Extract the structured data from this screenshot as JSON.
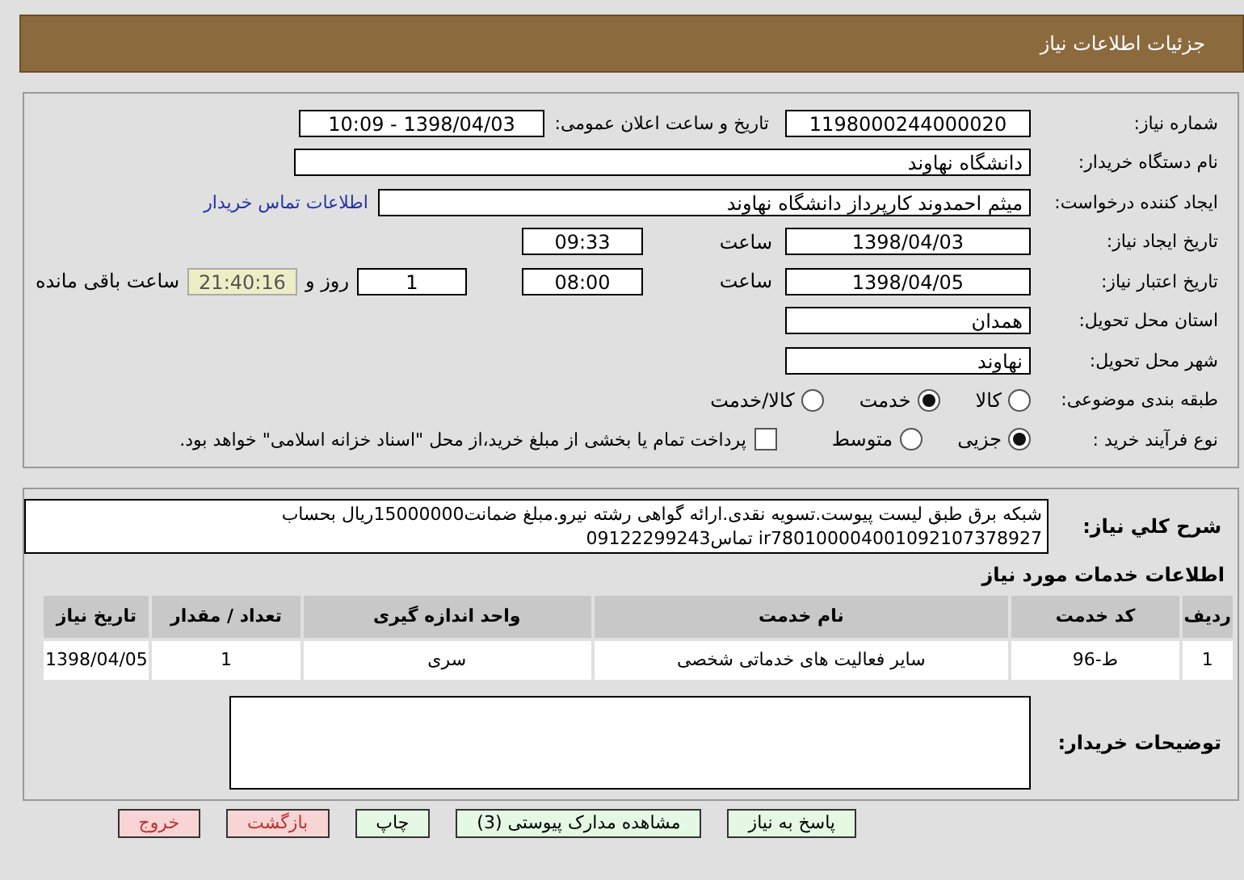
{
  "header": {
    "title": "جزئیات اطلاعات نیاز"
  },
  "form": {
    "need_number": {
      "label": "شماره نیاز:",
      "value": "1198000244000020"
    },
    "announce": {
      "label": "تاریخ و ساعت اعلان عمومی:",
      "value": "1398/04/03 - 10:09"
    },
    "buyer": {
      "label": "نام دستگاه خریدار:",
      "value": "دانشگاه نهاوند"
    },
    "creator": {
      "label": "ایجاد کننده درخواست:",
      "value": "میثم احمدوند کارپرداز دانشگاه نهاوند",
      "link": "اطلاعات تماس خریدار"
    },
    "created": {
      "label": "تاریخ ایجاد نیاز:",
      "date": "1398/04/03",
      "time_label": "ساعت",
      "time": "09:33"
    },
    "valid": {
      "label": "تاریخ اعتبار نیاز:",
      "date": "1398/04/05",
      "time_label": "ساعت",
      "time": "08:00",
      "days": "1",
      "days_label": "روز و",
      "remaining": "21:40:16",
      "remaining_label": "ساعت باقی مانده"
    },
    "province": {
      "label": "استان محل تحویل:",
      "value": "همدان"
    },
    "city": {
      "label": "شهر محل تحویل:",
      "value": "نهاوند"
    },
    "category": {
      "label": "طبقه بندی موضوعی:",
      "options": [
        {
          "label": "کالا",
          "selected": false
        },
        {
          "label": "خدمت",
          "selected": true
        },
        {
          "label": "کالا/خدمت",
          "selected": false
        }
      ]
    },
    "process": {
      "label": "نوع فرآیند خرید :",
      "options": [
        {
          "label": "جزیی",
          "selected": true
        },
        {
          "label": "متوسط",
          "selected": false
        }
      ],
      "payment": {
        "checked": false,
        "label": "پرداخت تمام یا بخشی از مبلغ خرید،از محل \"اسناد خزانه اسلامی\" خواهد بود."
      }
    }
  },
  "summary": {
    "label": "شرح کلي نیاز:",
    "text": "شبکه برق طبق لیست پیوست.تسویه نقدی.ارائه گواهی رشته نیرو.مبلغ ضمانت15000000ریال بحساب ir780100004001092107378927 تماس09122299243"
  },
  "services": {
    "title": "اطلاعات خدمات مورد نیاز",
    "columns": [
      "ردیف",
      "کد خدمت",
      "نام خدمت",
      "واحد اندازه گیری",
      "تعداد / مقدار",
      "تاریخ نیاز"
    ],
    "rows": [
      [
        "1",
        "ط-96",
        "سایر فعالیت های خدماتی شخصی",
        "سری",
        "1",
        "1398/04/05"
      ]
    ]
  },
  "notes": {
    "label": "توضیحات خریدار:"
  },
  "buttons": [
    {
      "label": "پاسخ به نیاز",
      "kind": "ok"
    },
    {
      "label": "مشاهده مدارک پیوستی (3)",
      "kind": "ok"
    },
    {
      "label": "چاپ",
      "kind": "ok"
    },
    {
      "label": "بازگشت",
      "kind": "warn"
    },
    {
      "label": "خروج",
      "kind": "warn"
    }
  ]
}
